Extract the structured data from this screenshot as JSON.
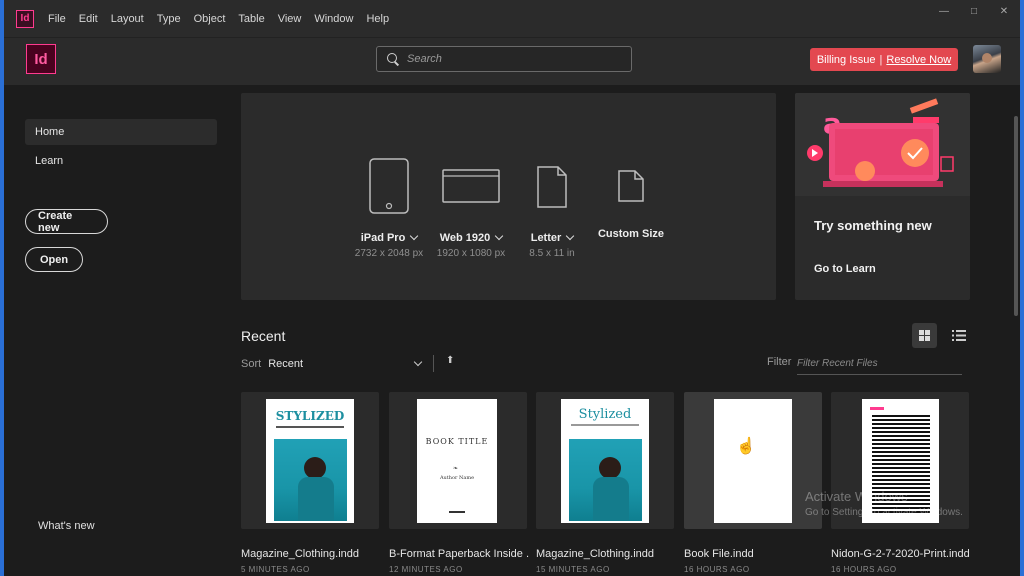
{
  "menubar": {
    "app_icon": "Id",
    "items": [
      "File",
      "Edit",
      "Layout",
      "Type",
      "Object",
      "Table",
      "View",
      "Window",
      "Help"
    ],
    "window_controls": [
      "minimize-icon",
      "maximize-icon",
      "close-icon"
    ]
  },
  "header": {
    "app_logo": "Id",
    "search_placeholder": "Search",
    "billing_issue": "Billing Issue",
    "billing_separator": "|",
    "resolve_now": "Resolve Now"
  },
  "sidebar": {
    "items": [
      {
        "label": "Home",
        "active": true
      },
      {
        "label": "Learn",
        "active": false
      }
    ],
    "create_new": "Create new",
    "open": "Open",
    "whats_new": "What's new"
  },
  "presets": [
    {
      "name": "iPad Pro",
      "size": "2732 x 2048 px",
      "icon": "tablet-icon"
    },
    {
      "name": "Web 1920",
      "size": "1920 x 1080 px",
      "icon": "browser-icon"
    },
    {
      "name": "Letter",
      "size": "8.5 x 11 in",
      "icon": "document-icon"
    },
    {
      "name": "Custom Size",
      "size": "",
      "icon": "document-icon"
    }
  ],
  "learn_card": {
    "title": "Try something new",
    "link": "Go to Learn"
  },
  "recent": {
    "heading": "Recent",
    "sort_label": "Sort",
    "sort_value": "Recent",
    "sort_direction_icon": "arrow-up-icon",
    "filter_label": "Filter",
    "filter_placeholder": "Filter Recent Files",
    "files": [
      {
        "name": "Magazine_Clothing.indd",
        "time": "5 MINUTES AGO",
        "thumb_title": "STYLIZED"
      },
      {
        "name": "B-Format Paperback Inside ...",
        "time": "12 MINUTES AGO",
        "thumb_title": "BOOK TITLE",
        "thumb_author": "Author Name"
      },
      {
        "name": "Magazine_Clothing.indd",
        "time": "15 MINUTES AGO",
        "thumb_title": "Stylized"
      },
      {
        "name": "Book File.indd",
        "time": "16 HOURS AGO",
        "thumb_title": ""
      },
      {
        "name": "Nidon-G-2-7-2020-Print.indd",
        "time": "16 HOURS AGO",
        "thumb_title": ""
      }
    ]
  },
  "watermark": {
    "line1": "Activate Windows",
    "line2": "Go to Settings to activate Windows."
  },
  "colors": {
    "accent_pink": "#ff3b8f",
    "billing_red": "#e34850",
    "teal": "#1c8fa0",
    "window_border": "#2a6fd6"
  }
}
